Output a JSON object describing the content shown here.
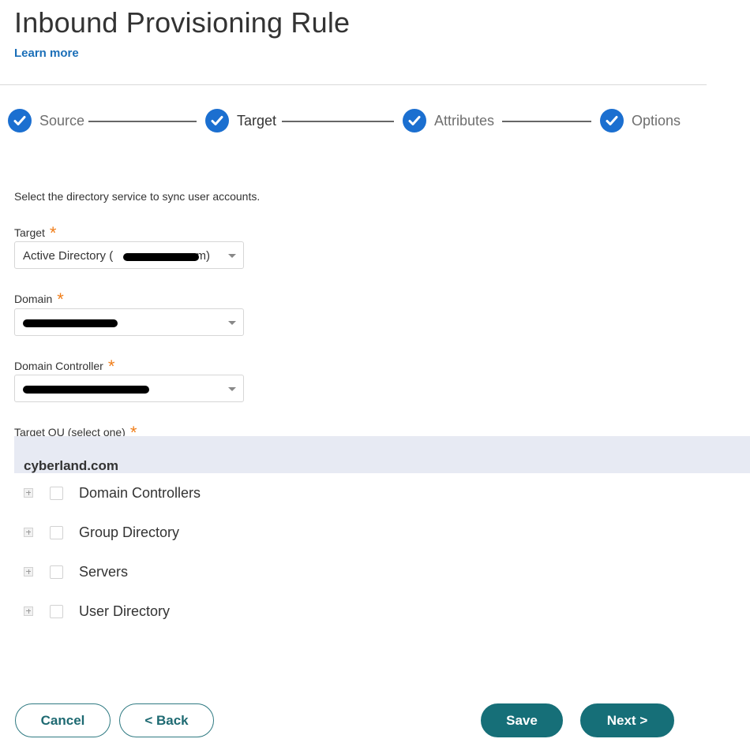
{
  "header": {
    "title": "Inbound Provisioning Rule",
    "learn_more": "Learn more"
  },
  "steps": [
    {
      "label": "Source",
      "completed": true,
      "active": false
    },
    {
      "label": "Target",
      "completed": true,
      "active": true
    },
    {
      "label": "Attributes",
      "completed": true,
      "active": false
    },
    {
      "label": "Options",
      "completed": true,
      "active": false
    }
  ],
  "form": {
    "description": "Select the directory service to sync user accounts.",
    "required_marker": "*",
    "target": {
      "label": "Target",
      "value_prefix": "Active Directory (",
      "value_suffix": "om)"
    },
    "domain": {
      "label": "Domain",
      "value": ""
    },
    "domain_controller": {
      "label": "Domain Controller",
      "value": ""
    },
    "target_ou": {
      "label": "Target OU (select one)"
    }
  },
  "tree": {
    "root": "cyberland.com",
    "items": [
      {
        "label": "Domain Controllers",
        "checked": false
      },
      {
        "label": "Group Directory",
        "checked": false
      },
      {
        "label": "Servers",
        "checked": false
      },
      {
        "label": "User Directory",
        "checked": false
      }
    ]
  },
  "buttons": {
    "cancel": "Cancel",
    "back": "< Back",
    "save": "Save",
    "next": "Next >"
  },
  "colors": {
    "step_check": "#1b6fd0",
    "link": "#1b6fb8",
    "required": "#f07e1a",
    "primary_button": "#166f78",
    "tree_header_bg": "#e7eaf3"
  }
}
